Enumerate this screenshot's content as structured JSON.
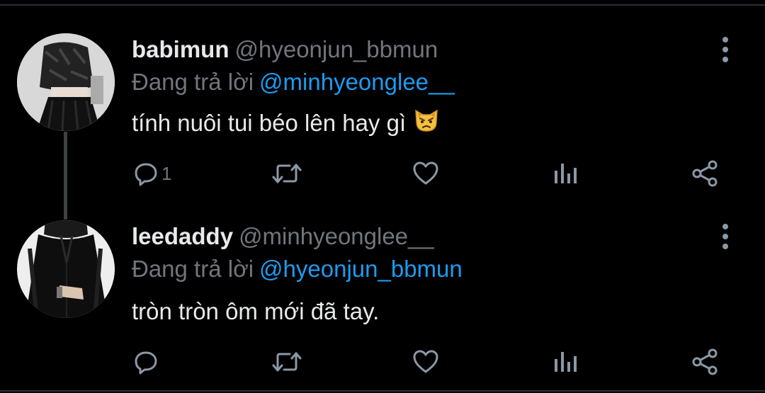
{
  "tweets": [
    {
      "display_name": "babimun",
      "handle": "@hyeonjun_bbmun",
      "reply_prefix": "Đang trả lời",
      "reply_to": "@minhyeonglee__",
      "text": "tính nuôi tui béo lên hay gì",
      "emoji": "pouting-cat-emoji",
      "reply_count": "1",
      "avatar_icon": "avatar-photo"
    },
    {
      "display_name": "leedaddy",
      "handle": "@minhyeonglee__",
      "reply_prefix": "Đang trả lời",
      "reply_to": "@hyeonjun_bbmun",
      "text": "tròn tròn ôm mới đã tay.",
      "reply_count": "",
      "avatar_icon": "avatar-photo"
    }
  ],
  "icons": {
    "reply": "reply-icon",
    "retweet": "retweet-icon",
    "like": "like-icon",
    "views": "views-icon",
    "share": "share-icon",
    "more": "more-options-icon"
  },
  "colors": {
    "background": "#000000",
    "primary_text": "#e7e9ea",
    "secondary_text": "#71767b",
    "accent": "#1d9bf0",
    "icon": "#8b98a5"
  }
}
